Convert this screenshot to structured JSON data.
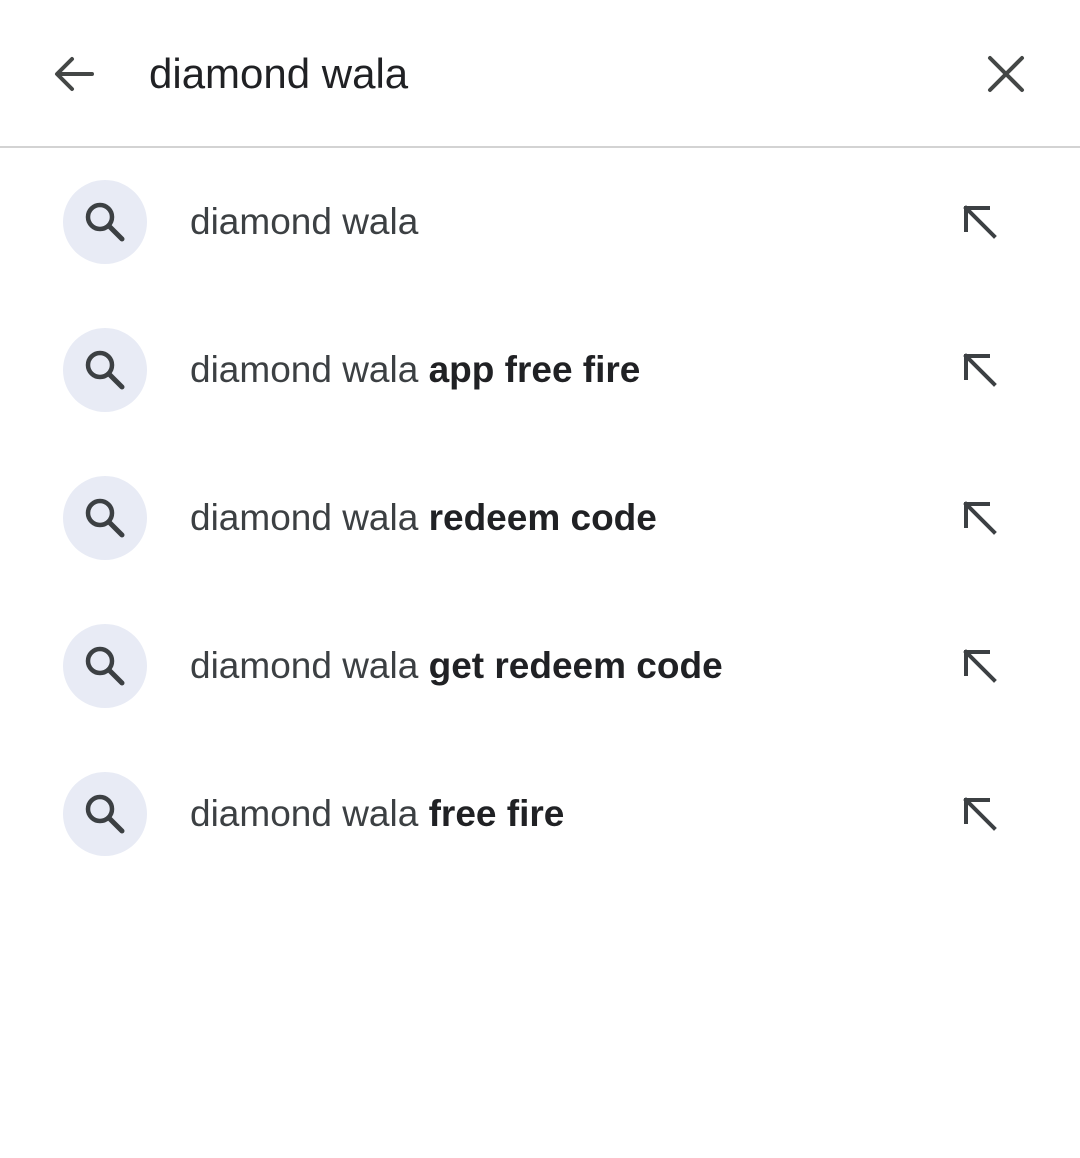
{
  "search": {
    "query": "diamond wala",
    "back_icon": "arrow-left-icon",
    "clear_icon": "close-icon"
  },
  "suggestions": [
    {
      "prefix": "diamond wala",
      "suffix": ""
    },
    {
      "prefix": "diamond wala",
      "suffix": " app free fire"
    },
    {
      "prefix": "diamond wala",
      "suffix": " redeem code"
    },
    {
      "prefix": "diamond wala",
      "suffix": " get redeem code"
    },
    {
      "prefix": "diamond wala",
      "suffix": " free fire"
    }
  ],
  "icons": {
    "suggestion_leading": "search-icon",
    "suggestion_trailing": "arrow-up-left-icon"
  },
  "colors": {
    "icon_circle_bg": "#e8ebf5",
    "text_primary": "#202124",
    "text_secondary": "#3c4043",
    "divider": "#d3d3d3"
  }
}
